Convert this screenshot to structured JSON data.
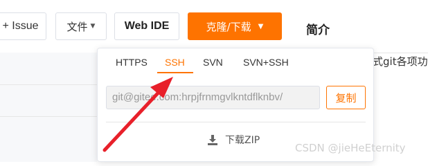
{
  "toolbar": {
    "issue_label": "+ Issue",
    "files_label": "文件",
    "webide_label": "Web IDE",
    "clone_label": "克隆/下载",
    "intro_title": "简介"
  },
  "background": {
    "right_text": "式git各项功"
  },
  "dropdown": {
    "tabs": [
      {
        "label": "HTTPS",
        "active": false
      },
      {
        "label": "SSH",
        "active": true
      },
      {
        "label": "SVN",
        "active": false
      },
      {
        "label": "SVN+SSH",
        "active": false
      }
    ],
    "url_value": "git@gitee.com:hrpjfrnmgvlkntdflknbv/",
    "copy_label": "复制",
    "download_label": "下载ZIP"
  },
  "watermark": "CSDN @jieHeEternity",
  "colors": {
    "accent": "#fe7300",
    "annotation_arrow": "#e8202a"
  },
  "icons": {
    "files_caret": "caret-down-icon",
    "clone_caret": "caret-down-icon",
    "download": "download-icon"
  }
}
